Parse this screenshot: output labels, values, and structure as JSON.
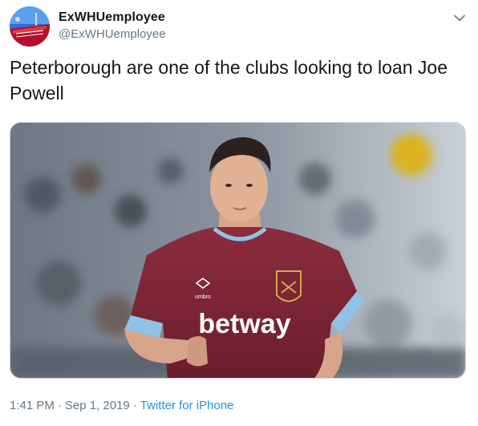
{
  "tweet": {
    "author": {
      "display_name": "ExWHUemployee",
      "handle": "@ExWHUemployee",
      "avatar_icon": "stadium-avatar-icon"
    },
    "text": "Peterborough are one of the clubs looking to loan Joe Powell",
    "media": {
      "shirt_sponsor": "betway",
      "kit_brand": "umbro",
      "description_icon": "player-photo"
    },
    "time": "1:41 PM",
    "date": "Sep 1, 2019",
    "separator": "·",
    "source": "Twitter for iPhone"
  },
  "colors": {
    "text_primary": "#14171a",
    "text_secondary": "#657786",
    "link": "#1b95e0",
    "border": "#ccd6dd",
    "claret": "#7a2636",
    "sky_blue": "#8fc3e6"
  }
}
